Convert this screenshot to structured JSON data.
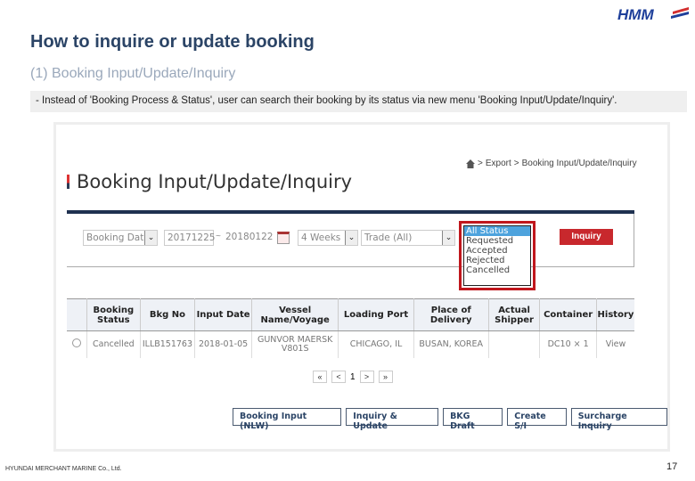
{
  "brand": {
    "logo_text": "HMM",
    "logo_color": "#1e3f9a",
    "logo_accent": "#d32f2f"
  },
  "slide": {
    "title": "How to inquire or update booking",
    "subtitle": "(1) Booking Input/Update/Inquiry",
    "note": "- Instead of 'Booking Process & Status', user can search their booking by its status via new menu 'Booking Input/Update/Inquiry'.",
    "footer_company": "HYUNDAI MERCHANT MARINE Co., Ltd.",
    "page_number": "17"
  },
  "screen": {
    "breadcrumb": {
      "items": [
        "Export",
        "Booking Input/Update/Inquiry"
      ],
      "separator": ">"
    },
    "page_heading": "Booking Input/Update/Inquiry",
    "filters": {
      "date_type": "Booking Date",
      "date_from": "20171225",
      "date_sep": "~",
      "date_to": "20180122",
      "period": "4 Weeks",
      "trade": "Trade (All)",
      "status_options": [
        "All Status",
        "Requested",
        "Accepted",
        "Rejected",
        "Cancelled"
      ],
      "status_selected": "All Status",
      "inquiry_button": "Inquiry"
    },
    "table": {
      "headers": [
        "",
        "Booking Status",
        "Bkg No",
        "Input Date",
        "Vessel Name/Voyage",
        "Loading Port",
        "Place of Delivery",
        "Actual Shipper",
        "Container",
        "History"
      ],
      "rows": [
        {
          "status": "Cancelled",
          "bkg_no": "ILLB151763",
          "input_date": "2018-01-05",
          "vessel": "GUNVOR MAERSK",
          "voyage": "V801S",
          "loading_port": "CHICAGO, IL",
          "delivery": "BUSAN, KOREA",
          "shipper": "",
          "container": "DC10 × 1",
          "history": "View"
        }
      ]
    },
    "pagination": {
      "first": "«",
      "prev": "<",
      "current": "1",
      "next": ">",
      "last": "»"
    },
    "actions": [
      "Booking Input (NLW)",
      "Inquiry & Update",
      "BKG Draft",
      "Create S/I",
      "Surcharge Inquiry"
    ]
  }
}
